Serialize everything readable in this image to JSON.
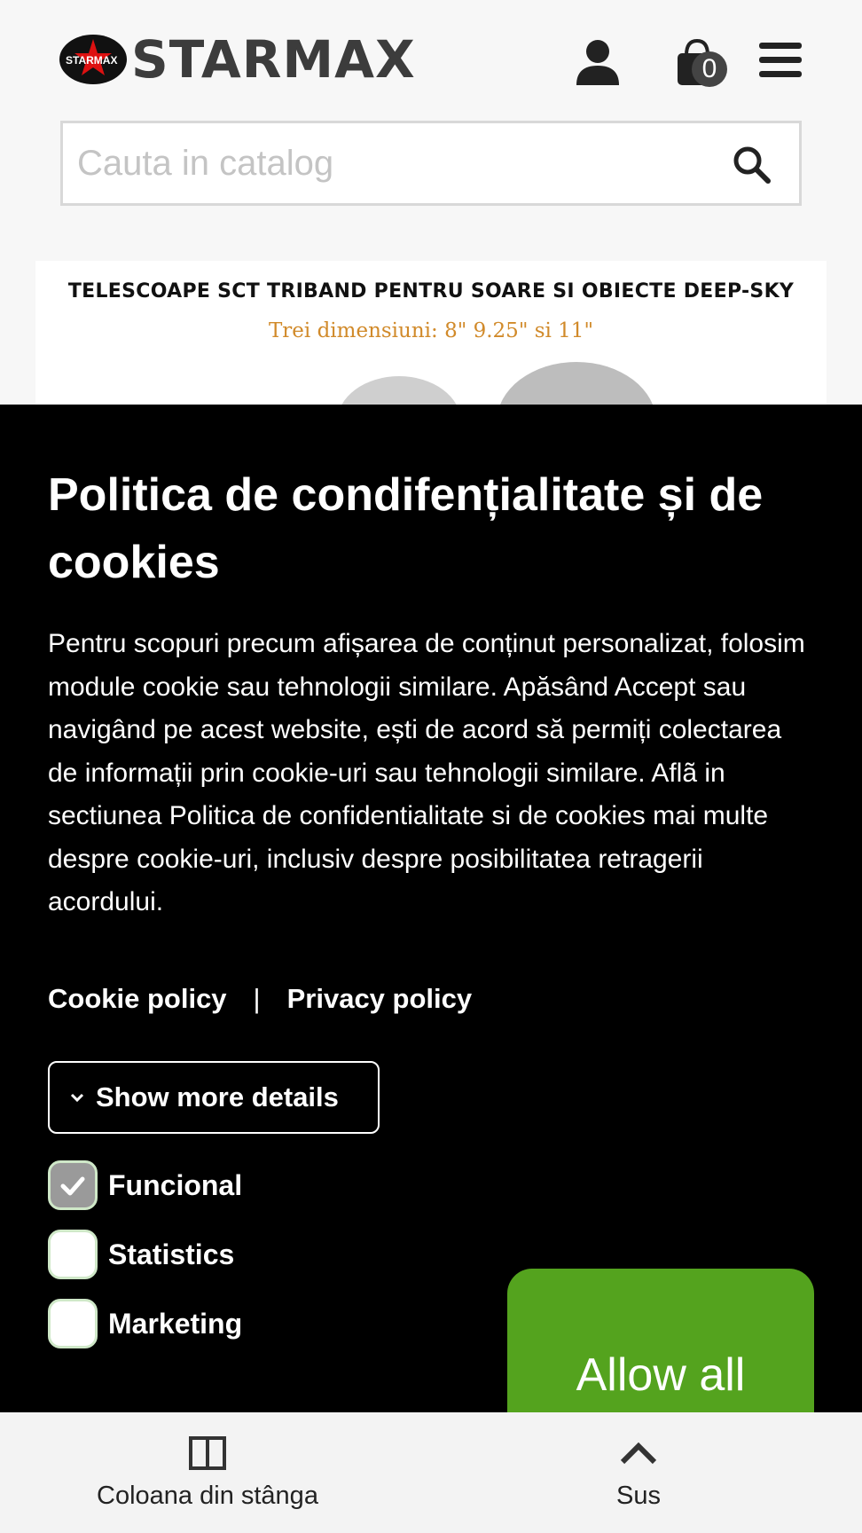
{
  "header": {
    "logo_text": "STARMAX",
    "logo_badge_text": "STARMAX",
    "cart_count": "0",
    "icons": [
      "user-icon",
      "cart-icon",
      "menu-icon"
    ]
  },
  "search": {
    "placeholder": "Cauta in catalog",
    "icon": "search-icon"
  },
  "banner": {
    "title": "TELESCOAPE SCT TRIBAND PENTRU SOARE SI OBIECTE DEEP-SKY",
    "subtitle": "Trei dimensiuni: 8\" 9.25\" si 11\""
  },
  "cookie": {
    "title": "Politica de condifențialitate și de cookies",
    "body": "Pentru scopuri precum afișarea de conținut personalizat, folosim module cookie sau tehnologii similare. Apăsând Accept sau navigând pe acest website, ești de acord să permiți colectarea de informații prin cookie-uri sau tehnologii similare. Aflã in sectiunea Politica de confidentialitate si de cookies mai multe despre cookie-uri, inclusiv despre posibilitatea retragerii acordului.",
    "cookie_policy_label": "Cookie policy",
    "separator": "|",
    "privacy_policy_label": "Privacy policy",
    "details_button_label": "Show more details",
    "options": [
      {
        "label": "Funcional",
        "checked": true
      },
      {
        "label": "Statistics",
        "checked": false
      },
      {
        "label": "Marketing",
        "checked": false
      }
    ],
    "allow_all_label": "Allow all",
    "accent_color": "#54a31e"
  },
  "bottom_bar": {
    "left_label": "Coloana din stânga",
    "right_label": "Sus"
  }
}
